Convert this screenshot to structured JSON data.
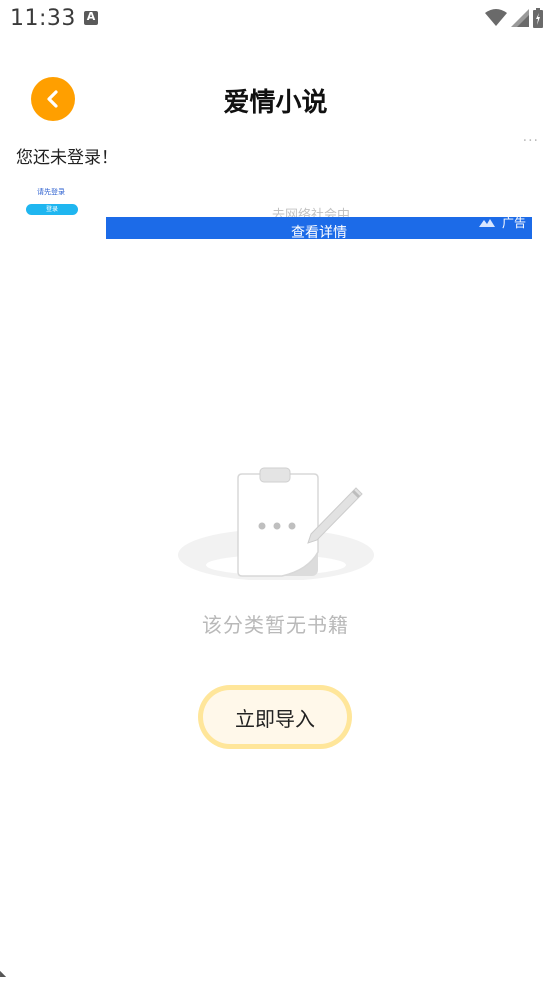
{
  "status_bar": {
    "time": "11:33",
    "app_icon_letter": "A"
  },
  "header": {
    "title": "爱情小说"
  },
  "login_notice": "您还未登录！",
  "ad": {
    "thumb_text": "请先登录",
    "thumb_button": "登录",
    "faded_text": "去网络社会中",
    "banner_label": "查看详情",
    "tag": "广告",
    "more": "···"
  },
  "empty_state": {
    "message": "该分类暂无书籍"
  },
  "import_button": {
    "label": "立即导入"
  },
  "colors": {
    "accent": "#ff9f00",
    "banner": "#1c6be8",
    "import_bg": "#ffe69a"
  }
}
